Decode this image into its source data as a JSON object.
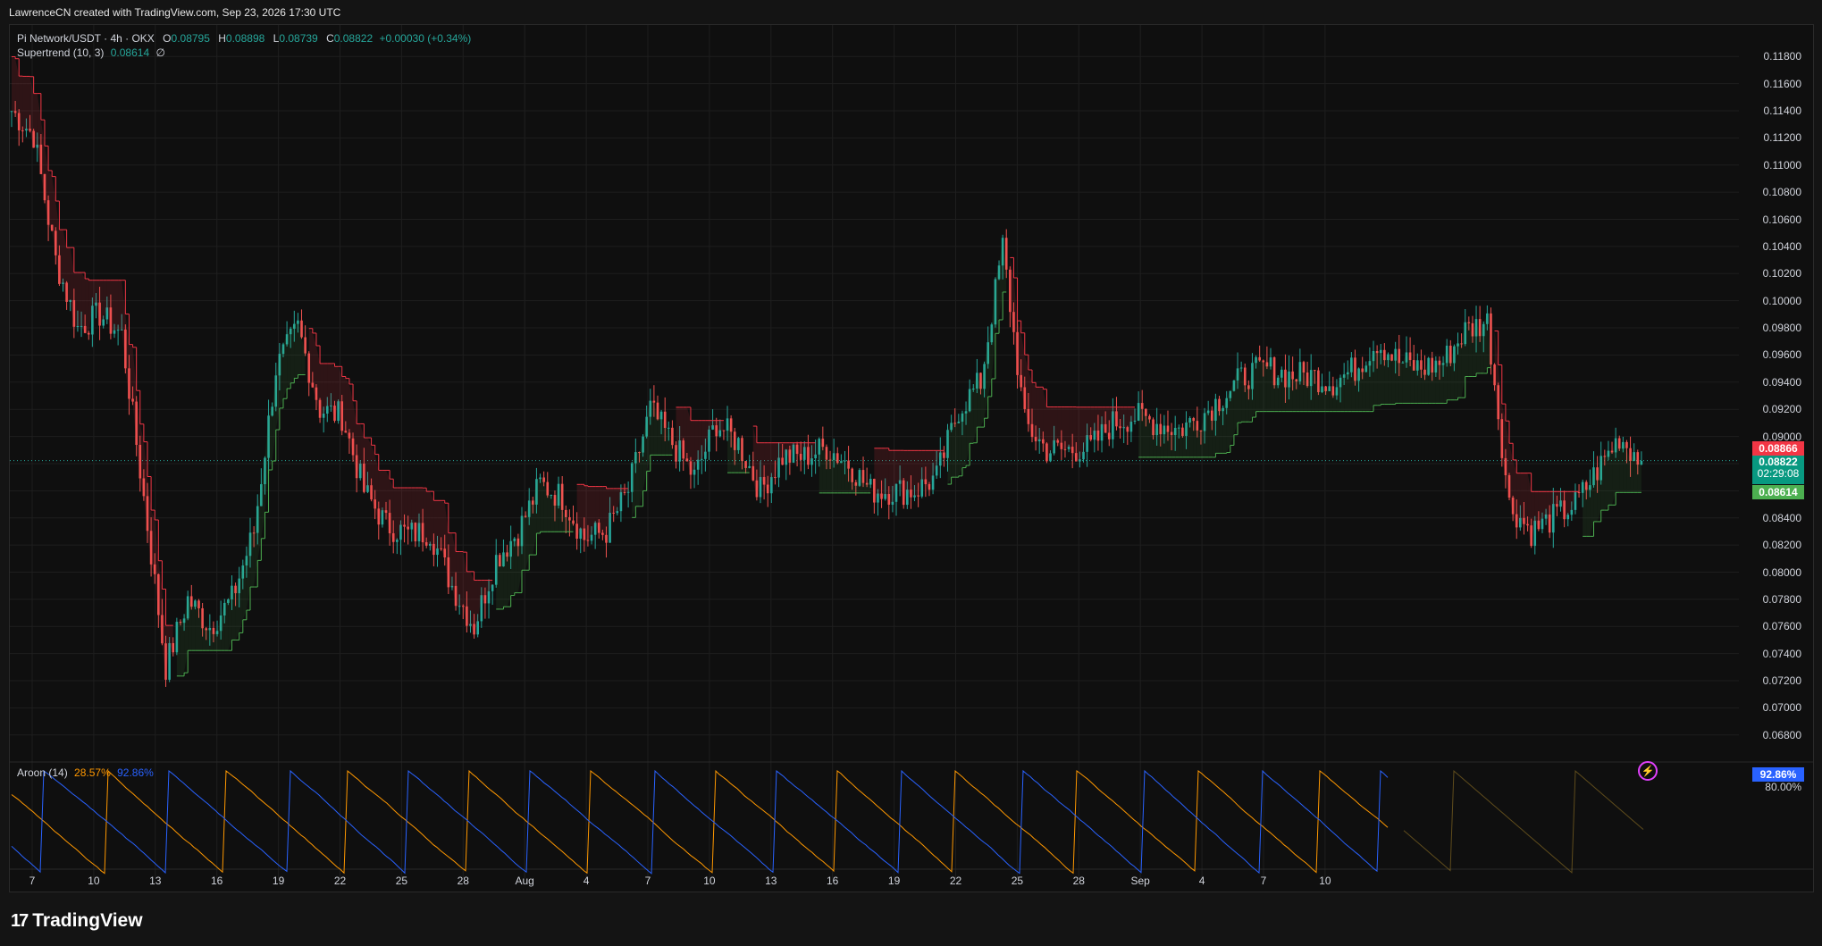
{
  "header": {
    "attribution": "LawrenceCN created with TradingView.com, Sep 23, 2026 17:30 UTC"
  },
  "symbol": {
    "name": "Pi Network/USDT · 4h · OKX",
    "o_label": "O",
    "o": "0.08795",
    "h_label": "H",
    "h": "0.08898",
    "l_label": "L",
    "l": "0.08739",
    "c_label": "C",
    "c": "0.08822",
    "change": "+0.00030 (+0.34%)"
  },
  "supertrend": {
    "label": "Supertrend (10, 3)",
    "value": "0.08614",
    "extra": "∅"
  },
  "aroon": {
    "label": "Aroon (14)",
    "up": "28.57%",
    "down": "92.86%"
  },
  "price_axis": {
    "ticks": [
      "0.11800",
      "0.11600",
      "0.11400",
      "0.11200",
      "0.11000",
      "0.10800",
      "0.10600",
      "0.10400",
      "0.10200",
      "0.10000",
      "0.09800",
      "0.09600",
      "0.09400",
      "0.09200",
      "0.09000",
      "0.08800",
      "0.08600",
      "0.08400",
      "0.08200",
      "0.08000",
      "0.07800",
      "0.07600",
      "0.07400",
      "0.07200",
      "0.07000",
      "0.06800"
    ],
    "tag_red": "0.08866",
    "tag_last": "0.08822",
    "tag_timer": "02:29:08",
    "tag_green": "0.08614"
  },
  "aroon_axis": {
    "tag_blue": "92.86%",
    "tick_80": "80.00%"
  },
  "x_axis": {
    "ticks": [
      "7",
      "10",
      "13",
      "16",
      "19",
      "22",
      "25",
      "28",
      "Aug",
      "4",
      "7",
      "10",
      "13",
      "16",
      "19",
      "22",
      "25",
      "28",
      "Sep",
      "4",
      "7",
      "10"
    ]
  },
  "colors": {
    "up": "#26a69a",
    "down": "#ef5350",
    "st_up": "#4caf50",
    "st_down": "#f23645",
    "aroon_up": "#ff9800",
    "aroon_down": "#2962ff",
    "accent_blue": "#2962ff"
  },
  "footer": {
    "brand": "TradingView"
  },
  "chart_data": {
    "type": "candlestick",
    "title": "Pi Network/USDT · 4h · OKX",
    "ylim": [
      0.067,
      0.119
    ],
    "x_categories": [
      "7",
      "10",
      "13",
      "16",
      "19",
      "22",
      "25",
      "28",
      "Aug",
      "4",
      "7",
      "10",
      "13",
      "16",
      "19",
      "22",
      "25",
      "28",
      "Sep",
      "4",
      "7",
      "10"
    ],
    "close_series": [
      {
        "date": "Jul 7",
        "value": 0.114
      },
      {
        "date": "Jul 8",
        "value": 0.1122
      },
      {
        "date": "Jul 9",
        "value": 0.103
      },
      {
        "date": "Jul 10",
        "value": 0.098
      },
      {
        "date": "Jul 11",
        "value": 0.099
      },
      {
        "date": "Jul 12",
        "value": 0.0975
      },
      {
        "date": "Jul 13",
        "value": 0.0855
      },
      {
        "date": "Jul 14",
        "value": 0.073
      },
      {
        "date": "Jul 15",
        "value": 0.078
      },
      {
        "date": "Jul 16",
        "value": 0.076
      },
      {
        "date": "Jul 17",
        "value": 0.078
      },
      {
        "date": "Jul 18",
        "value": 0.083
      },
      {
        "date": "Jul 19",
        "value": 0.095
      },
      {
        "date": "Jul 20",
        "value": 0.098
      },
      {
        "date": "Jul 21",
        "value": 0.092
      },
      {
        "date": "Jul 22",
        "value": 0.0915
      },
      {
        "date": "Jul 23",
        "value": 0.086
      },
      {
        "date": "Jul 24",
        "value": 0.0835
      },
      {
        "date": "Jul 25",
        "value": 0.0828
      },
      {
        "date": "Jul 26",
        "value": 0.083
      },
      {
        "date": "Jul 27",
        "value": 0.079
      },
      {
        "date": "Jul 28",
        "value": 0.076
      },
      {
        "date": "Jul 29",
        "value": 0.081
      },
      {
        "date": "Jul 30",
        "value": 0.083
      },
      {
        "date": "Jul 31",
        "value": 0.0865
      },
      {
        "date": "Aug 1",
        "value": 0.0855
      },
      {
        "date": "Aug 2",
        "value": 0.0825
      },
      {
        "date": "Aug 3",
        "value": 0.083
      },
      {
        "date": "Aug 4",
        "value": 0.086
      },
      {
        "date": "Aug 5",
        "value": 0.092
      },
      {
        "date": "Aug 6",
        "value": 0.0895
      },
      {
        "date": "Aug 7",
        "value": 0.087
      },
      {
        "date": "Aug 8",
        "value": 0.091
      },
      {
        "date": "Aug 9",
        "value": 0.0895
      },
      {
        "date": "Aug 10",
        "value": 0.086
      },
      {
        "date": "Aug 11",
        "value": 0.0885
      },
      {
        "date": "Aug 12",
        "value": 0.0885
      },
      {
        "date": "Aug 13",
        "value": 0.0892
      },
      {
        "date": "Aug 14",
        "value": 0.088
      },
      {
        "date": "Aug 15",
        "value": 0.086
      },
      {
        "date": "Aug 16",
        "value": 0.086
      },
      {
        "date": "Aug 17",
        "value": 0.086
      },
      {
        "date": "Aug 18",
        "value": 0.087
      },
      {
        "date": "Aug 19",
        "value": 0.092
      },
      {
        "date": "Aug 20",
        "value": 0.094
      },
      {
        "date": "Aug 21",
        "value": 0.104
      },
      {
        "date": "Aug 22",
        "value": 0.091
      },
      {
        "date": "Aug 23",
        "value": 0.089
      },
      {
        "date": "Aug 24",
        "value": 0.089
      },
      {
        "date": "Aug 25",
        "value": 0.0892
      },
      {
        "date": "Aug 26",
        "value": 0.091
      },
      {
        "date": "Aug 27",
        "value": 0.0915
      },
      {
        "date": "Aug 28",
        "value": 0.091
      },
      {
        "date": "Aug 29",
        "value": 0.0905
      },
      {
        "date": "Aug 30",
        "value": 0.0915
      },
      {
        "date": "Aug 31",
        "value": 0.093
      },
      {
        "date": "Sep 1",
        "value": 0.0945
      },
      {
        "date": "Sep 2",
        "value": 0.095
      },
      {
        "date": "Sep 3",
        "value": 0.0945
      },
      {
        "date": "Sep 4",
        "value": 0.0945
      },
      {
        "date": "Sep 5",
        "value": 0.094
      },
      {
        "date": "Sep 6",
        "value": 0.095
      },
      {
        "date": "Sep 7",
        "value": 0.097
      },
      {
        "date": "Sep 8",
        "value": 0.0955
      },
      {
        "date": "Sep 9",
        "value": 0.095
      },
      {
        "date": "Sep 10",
        "value": 0.0955
      },
      {
        "date": "Sep 11",
        "value": 0.0978
      },
      {
        "date": "Sep 12",
        "value": 0.0985
      },
      {
        "date": "Sep 13",
        "value": 0.085
      },
      {
        "date": "Sep 14",
        "value": 0.083
      },
      {
        "date": "Sep 15",
        "value": 0.084
      },
      {
        "date": "Sep 16",
        "value": 0.085
      },
      {
        "date": "Sep 17",
        "value": 0.0875
      },
      {
        "date": "Sep 18",
        "value": 0.09
      },
      {
        "date": "Sep 19",
        "value": 0.0882
      }
    ],
    "supertrend": {
      "last_value": 0.08614
    },
    "aroon": {
      "up": 28.57,
      "down": 92.86,
      "ylim": [
        0,
        100
      ]
    },
    "last_price": 0.08822
  }
}
